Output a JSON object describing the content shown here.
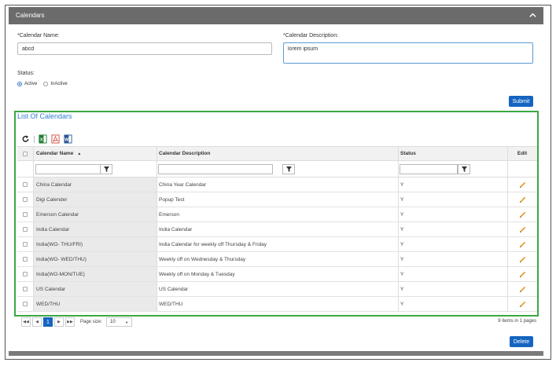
{
  "panel": {
    "title": "Calendars",
    "collapse_icon": "chevron-up-icon"
  },
  "form": {
    "name_label": "*Calendar Name:",
    "name_value": "abcd",
    "description_label": "*Calendar Description:",
    "description_value": "lorem ipsum",
    "status_label": "Status:",
    "status_options": [
      "Active",
      "InActive"
    ],
    "status_selected": "Active",
    "submit_label": "Submit"
  },
  "list": {
    "title": "List Of Calendars",
    "toolbar": [
      "refresh-icon",
      "excel-icon",
      "pdf-icon",
      "word-icon"
    ],
    "columns": {
      "name": "Calendar Name",
      "description": "Calendar Description",
      "status": "Status",
      "edit": "Edit"
    },
    "sort_indicator": "▲",
    "rows": [
      {
        "name": "China Calendar",
        "description": "China Year Calendar",
        "status": "Y"
      },
      {
        "name": "Digi Calender",
        "description": "Popup Test",
        "status": "Y"
      },
      {
        "name": "Emerson Calendar",
        "description": "Emerson",
        "status": "Y"
      },
      {
        "name": "India Calendar",
        "description": "India Calendar",
        "status": "Y"
      },
      {
        "name": "India(WO- THU/FRI)",
        "description": "India Calendar for weekly off Thursday & Friday",
        "status": "Y"
      },
      {
        "name": "India(WO- WED/THU)",
        "description": "Weekly off on Wednesday & Thursday",
        "status": "Y"
      },
      {
        "name": "India(WO-MON/TUE)",
        "description": "Weekly off on Monday & Tuesday",
        "status": "Y"
      },
      {
        "name": "US Calendar",
        "description": "US Calendar",
        "status": "Y"
      },
      {
        "name": "WED/THU",
        "description": "WED/THU",
        "status": "Y"
      }
    ]
  },
  "pager": {
    "current_page": "1",
    "page_size_label": "Page size:",
    "page_size": "10",
    "items_info": "9 items in 1 pages"
  },
  "actions": {
    "delete_label": "Delete"
  },
  "colors": {
    "accent": "#1565c0",
    "list_border": "#3aa843",
    "header_bg": "#6b6b6b",
    "edit_icon": "#e39a1d"
  }
}
